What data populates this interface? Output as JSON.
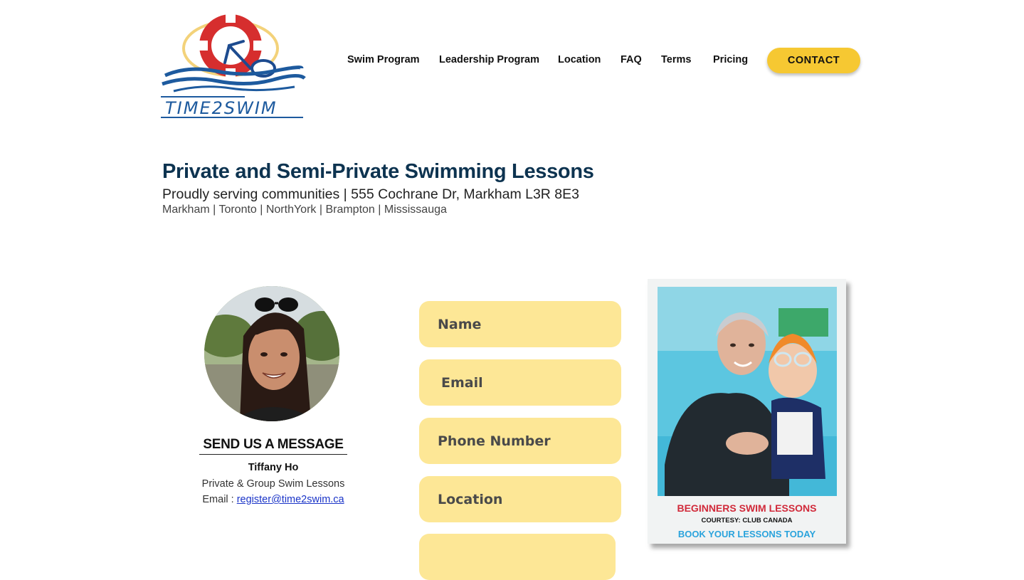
{
  "brand": {
    "logo_text": "TIME2SWIM"
  },
  "nav": {
    "items": [
      {
        "label": "Swim Program"
      },
      {
        "label": "Leadership Program"
      },
      {
        "label": "Location"
      },
      {
        "label": "FAQ"
      },
      {
        "label": "Terms"
      },
      {
        "label": "Pricing"
      }
    ],
    "contact_label": "CONTACT"
  },
  "hero": {
    "title": "Private and Semi-Private Swimming Lessons",
    "subtitle": "Proudly serving communities | 555 Cochrane Dr, Markham L3R 8E3",
    "cities": "Markham | Toronto | NorthYork | Brampton | Mississauga"
  },
  "contact": {
    "heading": "SEND US A MESSAGE",
    "name": "Tiffany Ho",
    "role": "Private & Group Swim Lessons",
    "email_prefix": "Email : ",
    "email": "register@time2swim.ca"
  },
  "form": {
    "name_placeholder": "Name",
    "email_placeholder": "Email",
    "phone_placeholder": "Phone Number",
    "location_placeholder": "Location"
  },
  "promo": {
    "caption_title": "BEGINNERS SWIM LESSONS",
    "caption_courtesy": "COURTESY: CLUB CANADA",
    "caption_cta": "BOOK YOUR LESSONS TODAY"
  },
  "colors": {
    "accent_yellow": "#f6c832",
    "field_yellow": "#fde796",
    "title_navy": "#0d3350",
    "link_blue": "#1a34c8"
  }
}
